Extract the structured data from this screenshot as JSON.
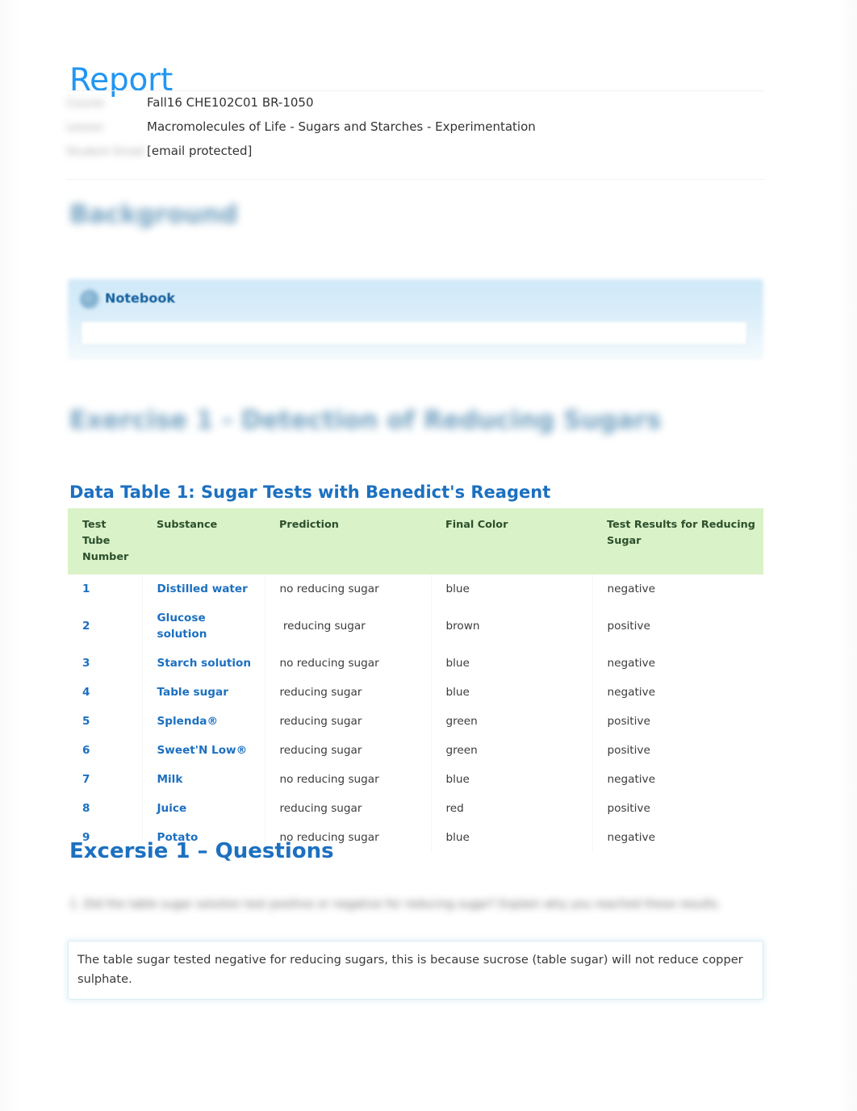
{
  "document": {
    "title": "Report",
    "title_color": "#2196f3"
  },
  "meta": {
    "rows": [
      {
        "label": "Course",
        "value": "Fall16 CHE102C01 BR-1050"
      },
      {
        "label": "Lesson",
        "value": "Macromolecules of Life - Sugars and Starches - Experimentation"
      },
      {
        "label": "Student Email",
        "value": "[email protected]"
      }
    ]
  },
  "sections": {
    "background_heading": "Background",
    "exercise_heading": "Exercise 1 - Detection of Reducing Sugars",
    "questions_heading": "Excersie 1 – Questions"
  },
  "notebook": {
    "label": "Notebook",
    "icon": "notebook-circle-icon",
    "input_value": "",
    "input_placeholder": "",
    "panel_color": "#cfe8f8",
    "label_color": "#14609e"
  },
  "data_table": {
    "title": "Data Table 1: Sugar Tests with Benedict's Reagent",
    "title_color": "#1c70c0",
    "header_background": "#d9f2c8",
    "header_text_color": "#2c4f2c",
    "link_color": "#1c70c0",
    "columns": [
      "Test Tube Number",
      "Substance",
      "Prediction",
      "Final Color",
      "Test Results for Reducing Sugar"
    ],
    "rows": [
      {
        "number": "1",
        "substance": "Distilled water",
        "prediction": "no reducing sugar",
        "final_color": "blue",
        "result": "negative"
      },
      {
        "number": "2",
        "substance": "Glucose solution",
        "prediction": " reducing sugar",
        "final_color": "brown",
        "result": "positive"
      },
      {
        "number": "3",
        "substance": "Starch solution",
        "prediction": "no reducing sugar",
        "final_color": "blue",
        "result": "negative"
      },
      {
        "number": "4",
        "substance": "Table sugar",
        "prediction": "reducing sugar",
        "final_color": "blue",
        "result": "negative"
      },
      {
        "number": "5",
        "substance": "Splenda®",
        "prediction": "reducing sugar",
        "final_color": "green",
        "result": "positive"
      },
      {
        "number": "6",
        "substance": "Sweet'N Low®",
        "prediction": "reducing sugar",
        "final_color": "green",
        "result": "positive"
      },
      {
        "number": "7",
        "substance": "Milk",
        "prediction": "no reducing sugar",
        "final_color": "blue",
        "result": "negative"
      },
      {
        "number": "8",
        "substance": "Juice",
        "prediction": "reducing sugar",
        "final_color": "red",
        "result": "positive"
      },
      {
        "number": "9",
        "substance": "Potato",
        "prediction": "no reducing sugar",
        "final_color": "blue",
        "result": "negative"
      }
    ]
  },
  "questions": {
    "question_1_text": "1. Did the table sugar solution test positive or negative for reducing sugar? Explain why you reached these results.",
    "answer_1": "The table sugar tested negative for reducing sugars, this is because sucrose (table sugar) will not reduce copper sulphate."
  }
}
